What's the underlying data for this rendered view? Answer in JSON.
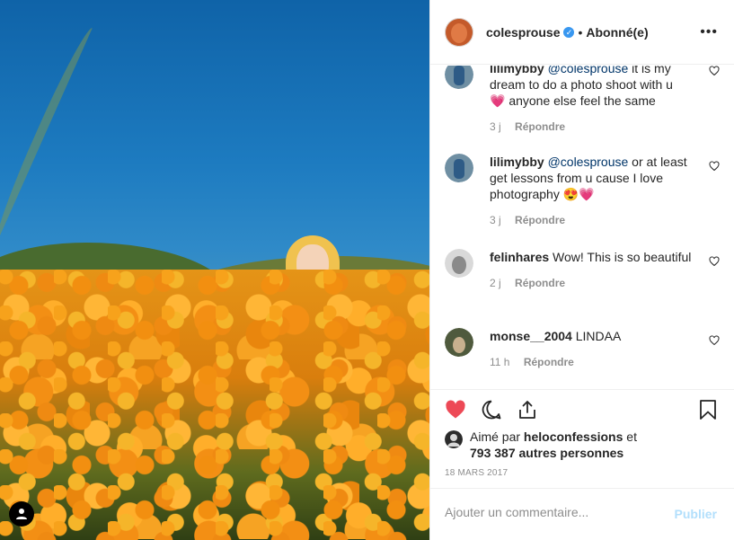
{
  "colors": {
    "like_red": "#ed4956",
    "link_blue": "#003569",
    "verified_blue": "#3897f0",
    "publish_disabled": "#b2dffc"
  },
  "post": {
    "username": "colesprouse",
    "verified": true,
    "separator": "•",
    "follow_state": "Abonné(e)",
    "more_icon": "more-dots-icon"
  },
  "comments": [
    {
      "author": "lilimybby",
      "mention": "@colesprouse",
      "text": " it is my dream to do a photo shoot with u 💗 anyone else feel the same",
      "time": "3 j",
      "reply": "Répondre"
    },
    {
      "author": "lilimybby",
      "mention": "@colesprouse",
      "text": " or at least get lessons from u cause I love photography 😍💗",
      "time": "3 j",
      "reply": "Répondre"
    },
    {
      "author": "felinhares",
      "mention": "",
      "text": "Wow! This is so beautiful",
      "time": "2 j",
      "reply": "Répondre"
    },
    {
      "author": "monse__2004",
      "mention": "",
      "text": "LINDAA",
      "time": "11 h",
      "reply": "Répondre"
    }
  ],
  "likes": {
    "prefix": "Aimé par",
    "liker": "heloconfessions",
    "conjunction": "et",
    "count": "793 387 autres personnes"
  },
  "date": "18 MARS 2017",
  "add_comment": {
    "placeholder": "Ajouter un commentaire...",
    "publish_label": "Publier"
  }
}
